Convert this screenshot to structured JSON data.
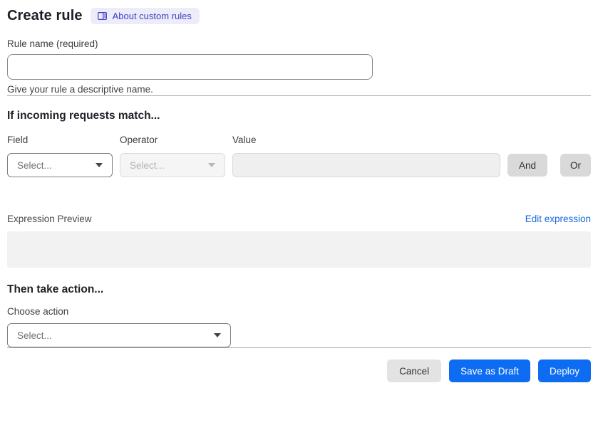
{
  "header": {
    "title": "Create rule",
    "about_link_label": "About custom rules"
  },
  "rule_name": {
    "label": "Rule name (required)",
    "value": "",
    "help_text": "Give your rule a descriptive name."
  },
  "match": {
    "heading": "If incoming requests match...",
    "field_label": "Field",
    "field_selected": "Select...",
    "operator_label": "Operator",
    "operator_selected": "Select...",
    "value_label": "Value",
    "value_text": "",
    "and_label": "And",
    "or_label": "Or"
  },
  "expression": {
    "preview_label": "Expression Preview",
    "edit_link_label": "Edit expression",
    "preview_content": ""
  },
  "action": {
    "heading": "Then take action...",
    "choose_label": "Choose action",
    "action_selected": "Select..."
  },
  "footer": {
    "cancel_label": "Cancel",
    "save_draft_label": "Save as Draft",
    "deploy_label": "Deploy"
  },
  "icons": {
    "about_badge_icon": "book-docs-icon",
    "select_caret_icon": "chevron-down-icon"
  },
  "colors": {
    "primary_blue": "#0e6cf2",
    "link_blue": "#1569de",
    "badge_background": "#ececfa",
    "badge_text": "#3d41c4",
    "neutral_button_gray": "#d9d9d9",
    "cancel_button_gray": "#e3e3e3",
    "disabled_field_gray": "#efefef",
    "preview_box_gray": "#f2f2f2"
  }
}
